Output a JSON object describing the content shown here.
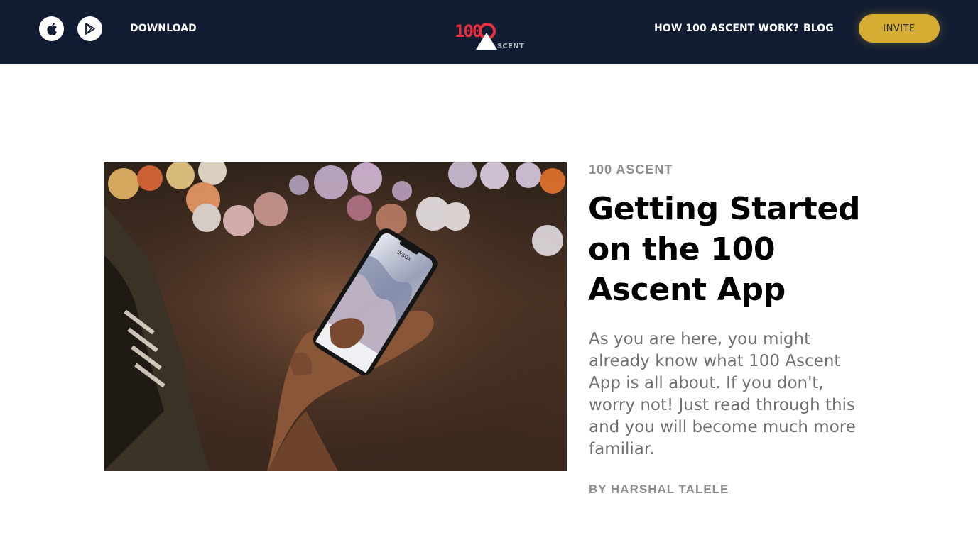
{
  "header": {
    "store_icons": [
      "apple-icon",
      "google-play-icon"
    ],
    "download_label": "DOWNLOAD",
    "logo": {
      "mark_text": "100",
      "word_text": "SCENT",
      "colors": {
        "red": "#e8303e",
        "white": "#ffffff",
        "grey": "#b9bcc6"
      }
    },
    "nav": {
      "how_label": "HOW 100 ASCENT WORK?",
      "blog_label": "BLOG",
      "invite_label": "INVITE"
    },
    "colors": {
      "background": "#121c33",
      "invite": "#d5ad33"
    }
  },
  "article": {
    "category": "100 ASCENT",
    "title": "Getting Started on the 100 Ascent App",
    "excerpt": "As you are here, you might already know what 100 Ascent App is all about. If you don't, worry not! Just read through this and you will become much more familiar.",
    "author": "BY HARSHAL TALELE",
    "image": {
      "description_icon": "phone-in-hand-photo",
      "phone_screen_text": "INBOX"
    }
  }
}
